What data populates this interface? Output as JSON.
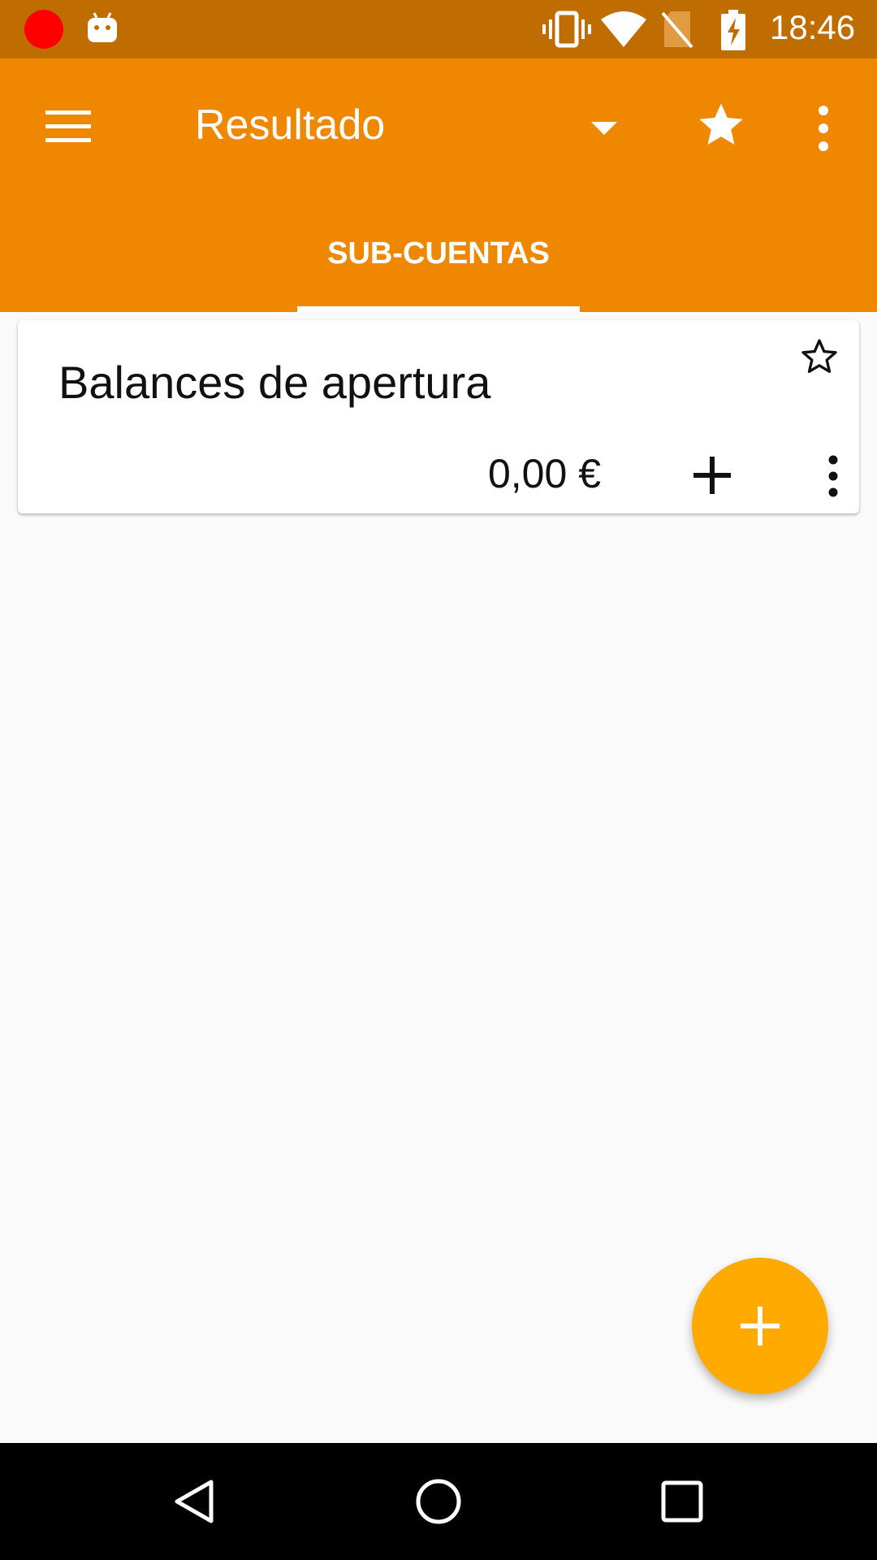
{
  "status_bar": {
    "time": "18:46",
    "icons": [
      "record-indicator",
      "android-debug-icon",
      "vibrate-icon",
      "wifi-icon",
      "no-sim-icon",
      "battery-charging-icon"
    ]
  },
  "app_bar": {
    "title": "Resultado",
    "icons": [
      "menu-icon",
      "dropdown-arrow-icon",
      "star-icon",
      "overflow-menu-icon"
    ],
    "tabs": [
      {
        "label": "SUB-CUENTAS",
        "selected": true
      }
    ]
  },
  "accounts": [
    {
      "name": "Balances de apertura",
      "balance": "0,00 €",
      "favorite": false
    }
  ],
  "fab": {
    "icon": "add-icon"
  },
  "nav_bar": {
    "icons": [
      "back-icon",
      "home-icon",
      "recents-icon"
    ]
  },
  "colors": {
    "status_bar": "#c06d00",
    "app_bar": "#ef8800",
    "fab": "#ffaa00",
    "background": "#fafafa"
  }
}
